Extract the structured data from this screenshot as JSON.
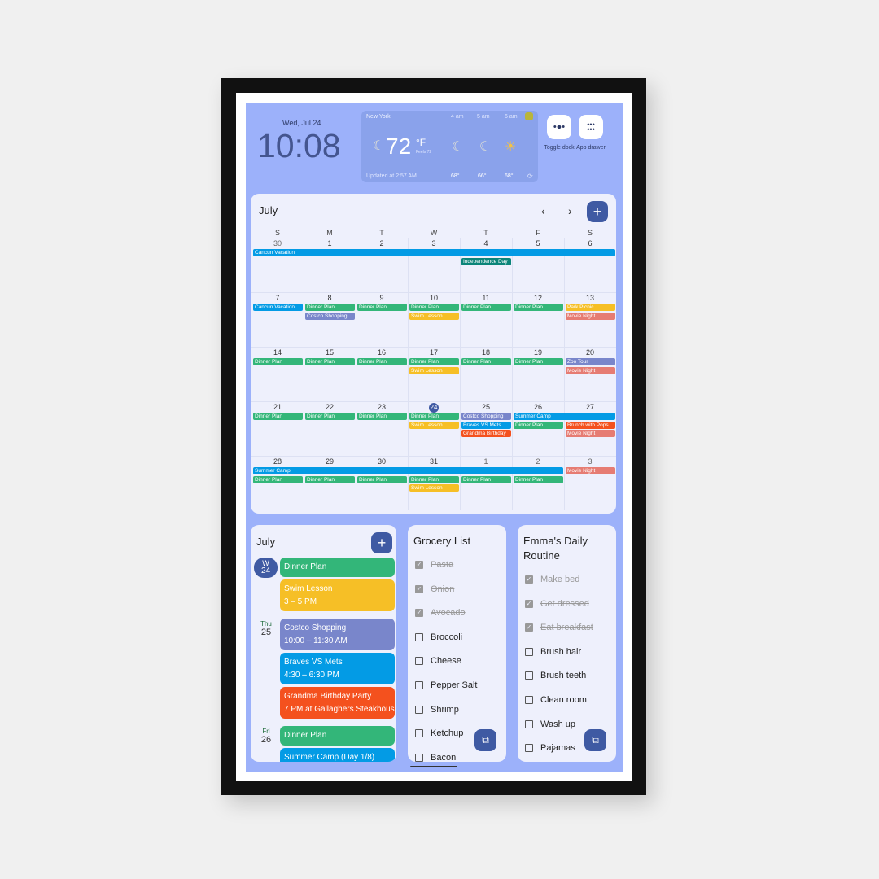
{
  "header": {
    "date": "Wed, Jul 24",
    "time": "10:08"
  },
  "weather": {
    "city": "New York",
    "temp": "72",
    "unit": "°F",
    "feels": "Feels 72",
    "updated": "Updated at 2:57 AM",
    "current_icon": "moon-icon",
    "hours": [
      {
        "label": "4 am",
        "icon": "moon-icon",
        "temp": "68°"
      },
      {
        "label": "5 am",
        "icon": "moon-icon",
        "temp": "66°"
      },
      {
        "label": "6 am",
        "icon": "sun-icon",
        "temp": "68°"
      }
    ]
  },
  "dock": {
    "toggle_label": "Toggle dock",
    "drawer_label": "App drawer"
  },
  "calendar": {
    "month": "July",
    "weekdays": [
      "S",
      "M",
      "T",
      "W",
      "T",
      "F",
      "S"
    ],
    "weeks": [
      [
        "30",
        "1",
        "2",
        "3",
        "4",
        "5",
        "6"
      ],
      [
        "7",
        "8",
        "9",
        "10",
        "11",
        "12",
        "13"
      ],
      [
        "14",
        "15",
        "16",
        "17",
        "18",
        "19",
        "20"
      ],
      [
        "21",
        "22",
        "23",
        "24",
        "25",
        "26",
        "27"
      ],
      [
        "28",
        "29",
        "30",
        "31",
        "1",
        "2",
        "3"
      ]
    ],
    "today": "24",
    "colors": {
      "green": "#33b679",
      "blue": "#039be5",
      "yellow": "#f6bf26",
      "purple": "#7986cb",
      "teal": "#0b8579",
      "orange": "#f4511e",
      "pink": "#e67c73"
    },
    "events": [
      {
        "week": 0,
        "day": 0,
        "span": 7,
        "label": "Cancun Vacation",
        "color": "blue"
      },
      {
        "week": 0,
        "day": 4,
        "span": 1,
        "label": "Independence Day",
        "color": "teal"
      },
      {
        "week": 1,
        "day": 0,
        "span": 1,
        "label": "Cancun Vacation",
        "color": "blue"
      },
      {
        "week": 1,
        "day": 1,
        "span": 1,
        "label": "Dinner Plan",
        "color": "green"
      },
      {
        "week": 1,
        "day": 2,
        "span": 1,
        "label": "Dinner Plan",
        "color": "green"
      },
      {
        "week": 1,
        "day": 3,
        "span": 1,
        "label": "Dinner Plan",
        "color": "green"
      },
      {
        "week": 1,
        "day": 4,
        "span": 1,
        "label": "Dinner Plan",
        "color": "green"
      },
      {
        "week": 1,
        "day": 5,
        "span": 1,
        "label": "Dinner Plan",
        "color": "green"
      },
      {
        "week": 1,
        "day": 6,
        "span": 1,
        "label": "Park Picnic",
        "color": "yellow"
      },
      {
        "week": 1,
        "day": 1,
        "span": 1,
        "label": "Costco Shopping",
        "color": "purple"
      },
      {
        "week": 1,
        "day": 3,
        "span": 1,
        "label": "Swim Lesson",
        "color": "yellow"
      },
      {
        "week": 1,
        "day": 6,
        "span": 1,
        "label": "Movie Night",
        "color": "pink"
      },
      {
        "week": 2,
        "day": 0,
        "span": 1,
        "label": "Dinner Plan",
        "color": "green"
      },
      {
        "week": 2,
        "day": 1,
        "span": 1,
        "label": "Dinner Plan",
        "color": "green"
      },
      {
        "week": 2,
        "day": 2,
        "span": 1,
        "label": "Dinner Plan",
        "color": "green"
      },
      {
        "week": 2,
        "day": 3,
        "span": 1,
        "label": "Dinner Plan",
        "color": "green"
      },
      {
        "week": 2,
        "day": 4,
        "span": 1,
        "label": "Dinner Plan",
        "color": "green"
      },
      {
        "week": 2,
        "day": 5,
        "span": 1,
        "label": "Dinner Plan",
        "color": "green"
      },
      {
        "week": 2,
        "day": 6,
        "span": 1,
        "label": "Zoo Tour",
        "color": "purple"
      },
      {
        "week": 2,
        "day": 3,
        "span": 1,
        "label": "Swim Lesson",
        "color": "yellow"
      },
      {
        "week": 2,
        "day": 6,
        "span": 1,
        "label": "Movie Night",
        "color": "pink"
      },
      {
        "week": 3,
        "day": 0,
        "span": 1,
        "label": "Dinner Plan",
        "color": "green"
      },
      {
        "week": 3,
        "day": 1,
        "span": 1,
        "label": "Dinner Plan",
        "color": "green"
      },
      {
        "week": 3,
        "day": 2,
        "span": 1,
        "label": "Dinner Plan",
        "color": "green"
      },
      {
        "week": 3,
        "day": 3,
        "span": 1,
        "label": "Dinner Plan",
        "color": "green"
      },
      {
        "week": 3,
        "day": 4,
        "span": 1,
        "label": "Costco Shopping",
        "color": "purple"
      },
      {
        "week": 3,
        "day": 5,
        "span": 2,
        "label": "Summer Camp",
        "color": "blue"
      },
      {
        "week": 3,
        "day": 3,
        "span": 1,
        "label": "Swim Lesson",
        "color": "yellow"
      },
      {
        "week": 3,
        "day": 4,
        "span": 1,
        "label": "Braves VS Mets",
        "color": "blue"
      },
      {
        "week": 3,
        "day": 5,
        "span": 1,
        "label": "Dinner Plan",
        "color": "green"
      },
      {
        "week": 3,
        "day": 6,
        "span": 1,
        "label": "Brunch with Pops",
        "color": "orange"
      },
      {
        "week": 3,
        "day": 4,
        "span": 1,
        "label": "Grandma Birthday",
        "color": "orange"
      },
      {
        "week": 3,
        "day": 6,
        "span": 1,
        "label": "Movie Night",
        "color": "pink"
      },
      {
        "week": 4,
        "day": 0,
        "span": 6,
        "label": "Summer Camp",
        "color": "blue"
      },
      {
        "week": 4,
        "day": 6,
        "span": 1,
        "label": "Movie Night",
        "color": "pink"
      },
      {
        "week": 4,
        "day": 0,
        "span": 1,
        "label": "Dinner Plan",
        "color": "green"
      },
      {
        "week": 4,
        "day": 1,
        "span": 1,
        "label": "Dinner Plan",
        "color": "green"
      },
      {
        "week": 4,
        "day": 2,
        "span": 1,
        "label": "Dinner Plan",
        "color": "green"
      },
      {
        "week": 4,
        "day": 3,
        "span": 1,
        "label": "Dinner Plan",
        "color": "green"
      },
      {
        "week": 4,
        "day": 4,
        "span": 1,
        "label": "Dinner Plan",
        "color": "green"
      },
      {
        "week": 4,
        "day": 5,
        "span": 1,
        "label": "Dinner Plan",
        "color": "green"
      },
      {
        "week": 4,
        "day": 3,
        "span": 1,
        "label": "Swim Lesson",
        "color": "yellow"
      }
    ]
  },
  "agenda": {
    "month": "July",
    "days": [
      {
        "dow": "W",
        "num": "24",
        "today": true,
        "events": [
          {
            "title": "Dinner Plan",
            "time": "",
            "color": "#33b679"
          },
          {
            "title": "Swim Lesson",
            "time": "3 – 5 PM",
            "color": "#f6bf26"
          }
        ]
      },
      {
        "dow": "Thu",
        "num": "25",
        "events": [
          {
            "title": "Costco Shopping",
            "time": "10:00 – 11:30 AM",
            "color": "#7986cb"
          },
          {
            "title": "Braves VS Mets",
            "time": "4:30 – 6:30 PM",
            "color": "#039be5"
          },
          {
            "title": "Grandma Birthday Party",
            "time": "7 PM at Gallaghers Steakhouse",
            "color": "#f4511e"
          }
        ]
      },
      {
        "dow": "Fri",
        "num": "26",
        "events": [
          {
            "title": "Dinner Plan",
            "time": "",
            "color": "#33b679"
          },
          {
            "title": "Summer Camp (Day 1/8)",
            "time": "",
            "color": "#039be5"
          }
        ]
      }
    ]
  },
  "grocery": {
    "title": "Grocery List",
    "items": [
      {
        "label": "Pasta",
        "done": true
      },
      {
        "label": "Onion",
        "done": true
      },
      {
        "label": "Avocado",
        "done": true
      },
      {
        "label": "Broccoli",
        "done": false
      },
      {
        "label": "Cheese",
        "done": false
      },
      {
        "label": "Pepper Salt",
        "done": false
      },
      {
        "label": "Shrimp",
        "done": false
      },
      {
        "label": "Ketchup",
        "done": false
      },
      {
        "label": "Bacon",
        "done": false
      }
    ]
  },
  "routine": {
    "title": "Emma's Daily Routine",
    "items": [
      {
        "label": "Make bed",
        "done": true
      },
      {
        "label": "Get dressed",
        "done": true
      },
      {
        "label": "Eat breakfast",
        "done": true
      },
      {
        "label": "Brush hair",
        "done": false
      },
      {
        "label": "Brush teeth",
        "done": false
      },
      {
        "label": "Clean room",
        "done": false
      },
      {
        "label": "Wash up",
        "done": false
      },
      {
        "label": "Pajamas",
        "done": false
      }
    ]
  }
}
